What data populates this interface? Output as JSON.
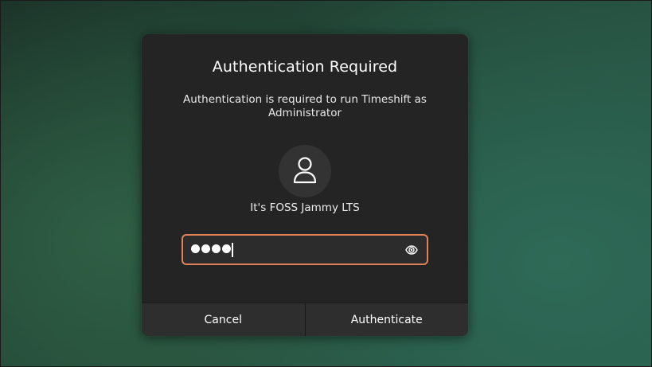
{
  "dialog": {
    "title": "Authentication Required",
    "description": "Authentication is required to run Timeshift as Administrator",
    "user": {
      "name": "It's FOSS Jammy LTS",
      "avatar_icon": "user-icon"
    },
    "password": {
      "masked_character_count": 4,
      "reveal_icon": "eye-icon",
      "focus_color": "#e08158"
    },
    "buttons": {
      "cancel_label": "Cancel",
      "authenticate_label": "Authenticate"
    }
  },
  "annotation": {
    "arrow_icon": "red-arrow-icon",
    "arrow_color": "#e8443a"
  }
}
